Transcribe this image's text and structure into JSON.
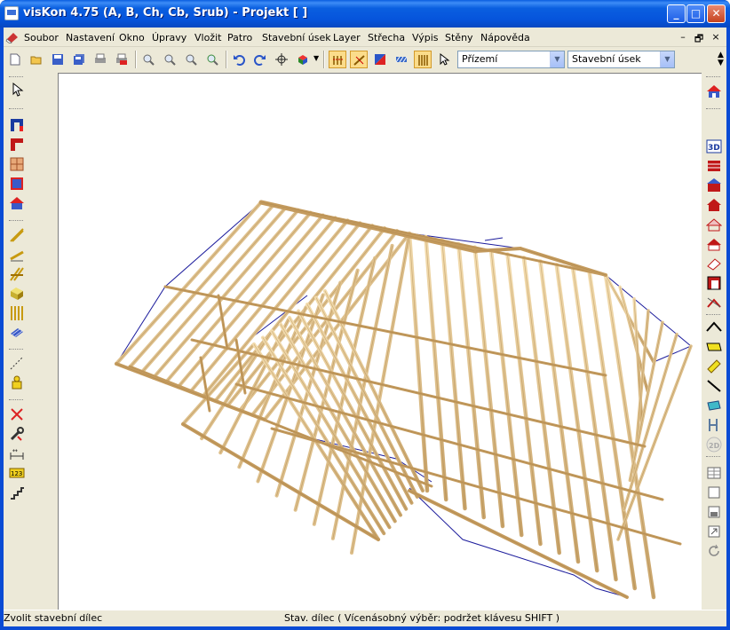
{
  "window": {
    "title": "visKon 4.75 (A, B, Ch, Cb, Srub) - Projekt [  ]",
    "minimize": "_",
    "maximize": "□",
    "close": "✕"
  },
  "menu": {
    "items": [
      {
        "label": "Soubor"
      },
      {
        "label": "Nastavení"
      },
      {
        "label": "Okno"
      },
      {
        "label": "Úpravy"
      },
      {
        "label": "Vložit"
      },
      {
        "label": "Patro"
      },
      {
        "label": "Stavební úsek"
      },
      {
        "label": "Layer"
      },
      {
        "label": "Střecha"
      },
      {
        "label": "Výpis"
      },
      {
        "label": "Stěny"
      },
      {
        "label": "Nápověda"
      }
    ],
    "mdi_min": "–",
    "mdi_restore": "🗗",
    "mdi_close": "×"
  },
  "toolbar": {
    "floor_select": "Přízemí",
    "section_select": "Stavební úsek"
  },
  "status": {
    "left": "Zvolit stavební dílec",
    "center": "Stav. dílec (  Vícenásobný výběr: podržet klávesu SHIFT )"
  },
  "icons": {
    "top": [
      "new-file-icon",
      "open-folder-icon",
      "save-icon",
      "save-all-icon",
      "print-icon",
      "pdf-icon",
      "zoom-in-icon",
      "zoom-out-icon",
      "zoom-window-icon",
      "zoom-all-icon",
      "undo-icon",
      "redo-icon",
      "crosshair-icon",
      "3d-cube-icon",
      "beam-select-icon",
      "rafter-icon",
      "roof-plane-icon",
      "hatch-icon",
      "wall-studs-icon",
      "pointer-icon"
    ],
    "left": [
      "pointer-icon",
      "door-icon",
      "corner-wall-icon",
      "window-icon",
      "hatched-panel-icon",
      "house-icon",
      "beam-icon",
      "inclined-beam-icon",
      "purlin-icon",
      "block-icon",
      "studs-icon",
      "slab-icon",
      "dashed-line-icon",
      "figure-icon",
      "delete-icon",
      "tools-icon",
      "dimension-icon",
      "numbering-icon",
      "stairs-icon"
    ],
    "right": [
      "house-view-icon",
      "3d-view-icon",
      "roof-red-icon",
      "roof-truss-icon",
      "house-red-icon",
      "house-outline-icon",
      "house-hatched-icon",
      "eraser-icon",
      "frame-icon",
      "gable-icon",
      "roof-outline-icon",
      "yellow-panel-icon",
      "yellow-bar-icon",
      "line-icon",
      "slab-view-icon",
      "joint-icon",
      "2d-icon",
      "table-icon",
      "blank-page-icon",
      "page-icon",
      "expand-icon",
      "refresh-icon"
    ]
  }
}
